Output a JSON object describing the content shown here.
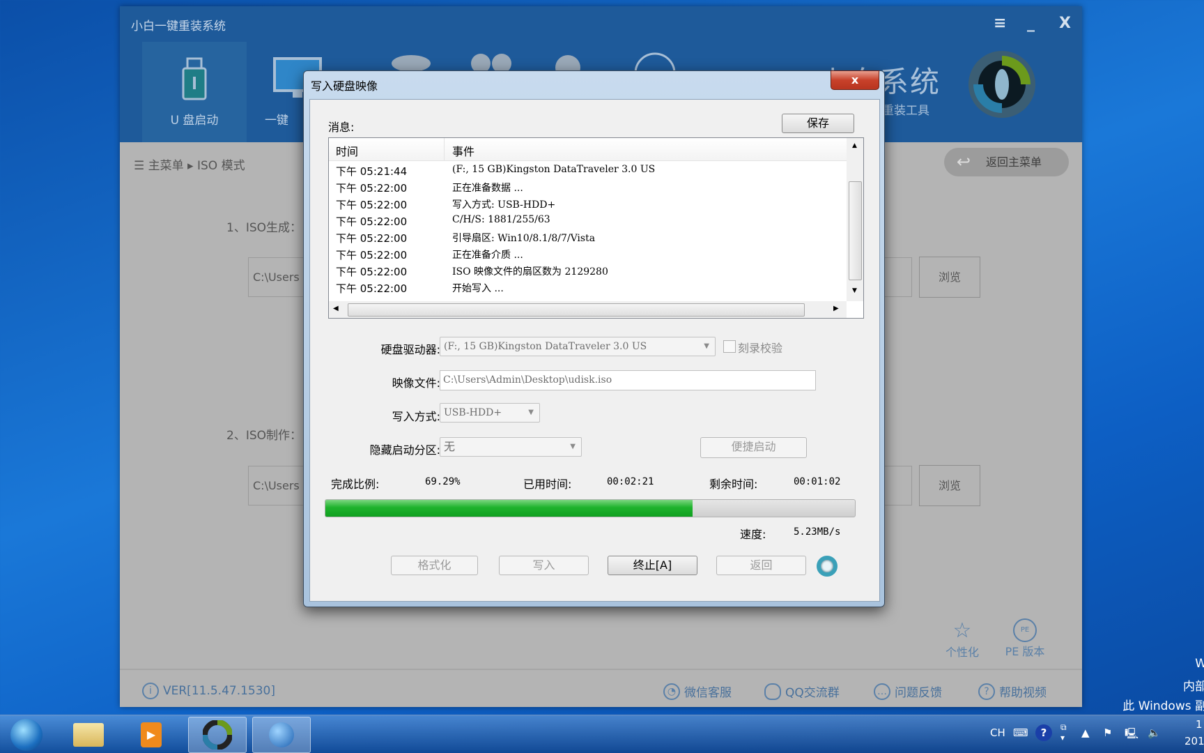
{
  "app": {
    "title": "小白一键重装系统",
    "window_controls": {
      "menu": "≡",
      "minimize": "_",
      "close": "X"
    },
    "nav": [
      {
        "label": "U 盘启动",
        "active": true
      },
      {
        "label": "一键"
      }
    ],
    "brand": {
      "title": "小白系统",
      "subtitle": "系统重装工具"
    },
    "breadcrumb": {
      "root": "主菜单",
      "current": "ISO 模式"
    },
    "back_button": "返回主菜单",
    "section1": {
      "label": "1、ISO生成：",
      "path": "C:\\Users",
      "browse": "浏览"
    },
    "section2": {
      "label": "2、ISO制作：",
      "path": "C:\\Users",
      "browse": "浏览"
    },
    "quick": [
      {
        "label": "个性化",
        "icon": "personalize-icon"
      },
      {
        "label": "PE 版本",
        "icon": "pe-icon"
      }
    ],
    "footer": {
      "version": "VER[11.5.47.1530]",
      "links": [
        "微信客服",
        "QQ交流群",
        "问题反馈",
        "帮助视频"
      ]
    }
  },
  "dialog": {
    "title": "写入硬盘映像",
    "close": "x",
    "messages_label": "消息:",
    "save": "保存",
    "columns": [
      "时间",
      "事件"
    ],
    "log": [
      {
        "time": "下午 05:21:44",
        "event": "(F:, 15 GB)Kingston DataTraveler 3.0 US"
      },
      {
        "time": "下午 05:22:00",
        "event": "正在准备数据 ..."
      },
      {
        "time": "下午 05:22:00",
        "event": "写入方式: USB-HDD+"
      },
      {
        "time": "下午 05:22:00",
        "event": "C/H/S: 1881/255/63"
      },
      {
        "time": "下午 05:22:00",
        "event": "引导扇区: Win10/8.1/8/7/Vista"
      },
      {
        "time": "下午 05:22:00",
        "event": "正在准备介质 ..."
      },
      {
        "time": "下午 05:22:00",
        "event": "ISO 映像文件的扇区数为 2129280"
      },
      {
        "time": "下午 05:22:00",
        "event": "开始写入 ..."
      }
    ],
    "drive_label": "硬盘驱动器:",
    "drive_value": "(F:, 15 GB)Kingston DataTraveler 3.0 US",
    "verify_label": "刻录校验",
    "verify_checked": false,
    "image_label": "映像文件:",
    "image_value": "C:\\Users\\Admin\\Desktop\\udisk.iso",
    "mode_label": "写入方式:",
    "mode_value": "USB-HDD+",
    "hide_label": "隐藏启动分区:",
    "hide_value": "无",
    "quick_boot": "便捷启动",
    "progress_label": "完成比例:",
    "progress_text": "69.29%",
    "progress_percent": 69.29,
    "elapsed_label": "已用时间:",
    "elapsed": "00:02:21",
    "remaining_label": "剩余时间:",
    "remaining": "00:01:02",
    "speed_label": "速度:",
    "speed": "5.23MB/s",
    "buttons": {
      "format": "格式化",
      "write": "写入",
      "stop": "终止[A]",
      "back": "返回"
    },
    "colors": {
      "progress": "#1fb32d"
    }
  },
  "desktop": {
    "watermark": [
      "W",
      "内部",
      "此 Windows 副"
    ]
  },
  "taskbar": {
    "ime": "CH",
    "clock": [
      "1",
      "201"
    ]
  }
}
